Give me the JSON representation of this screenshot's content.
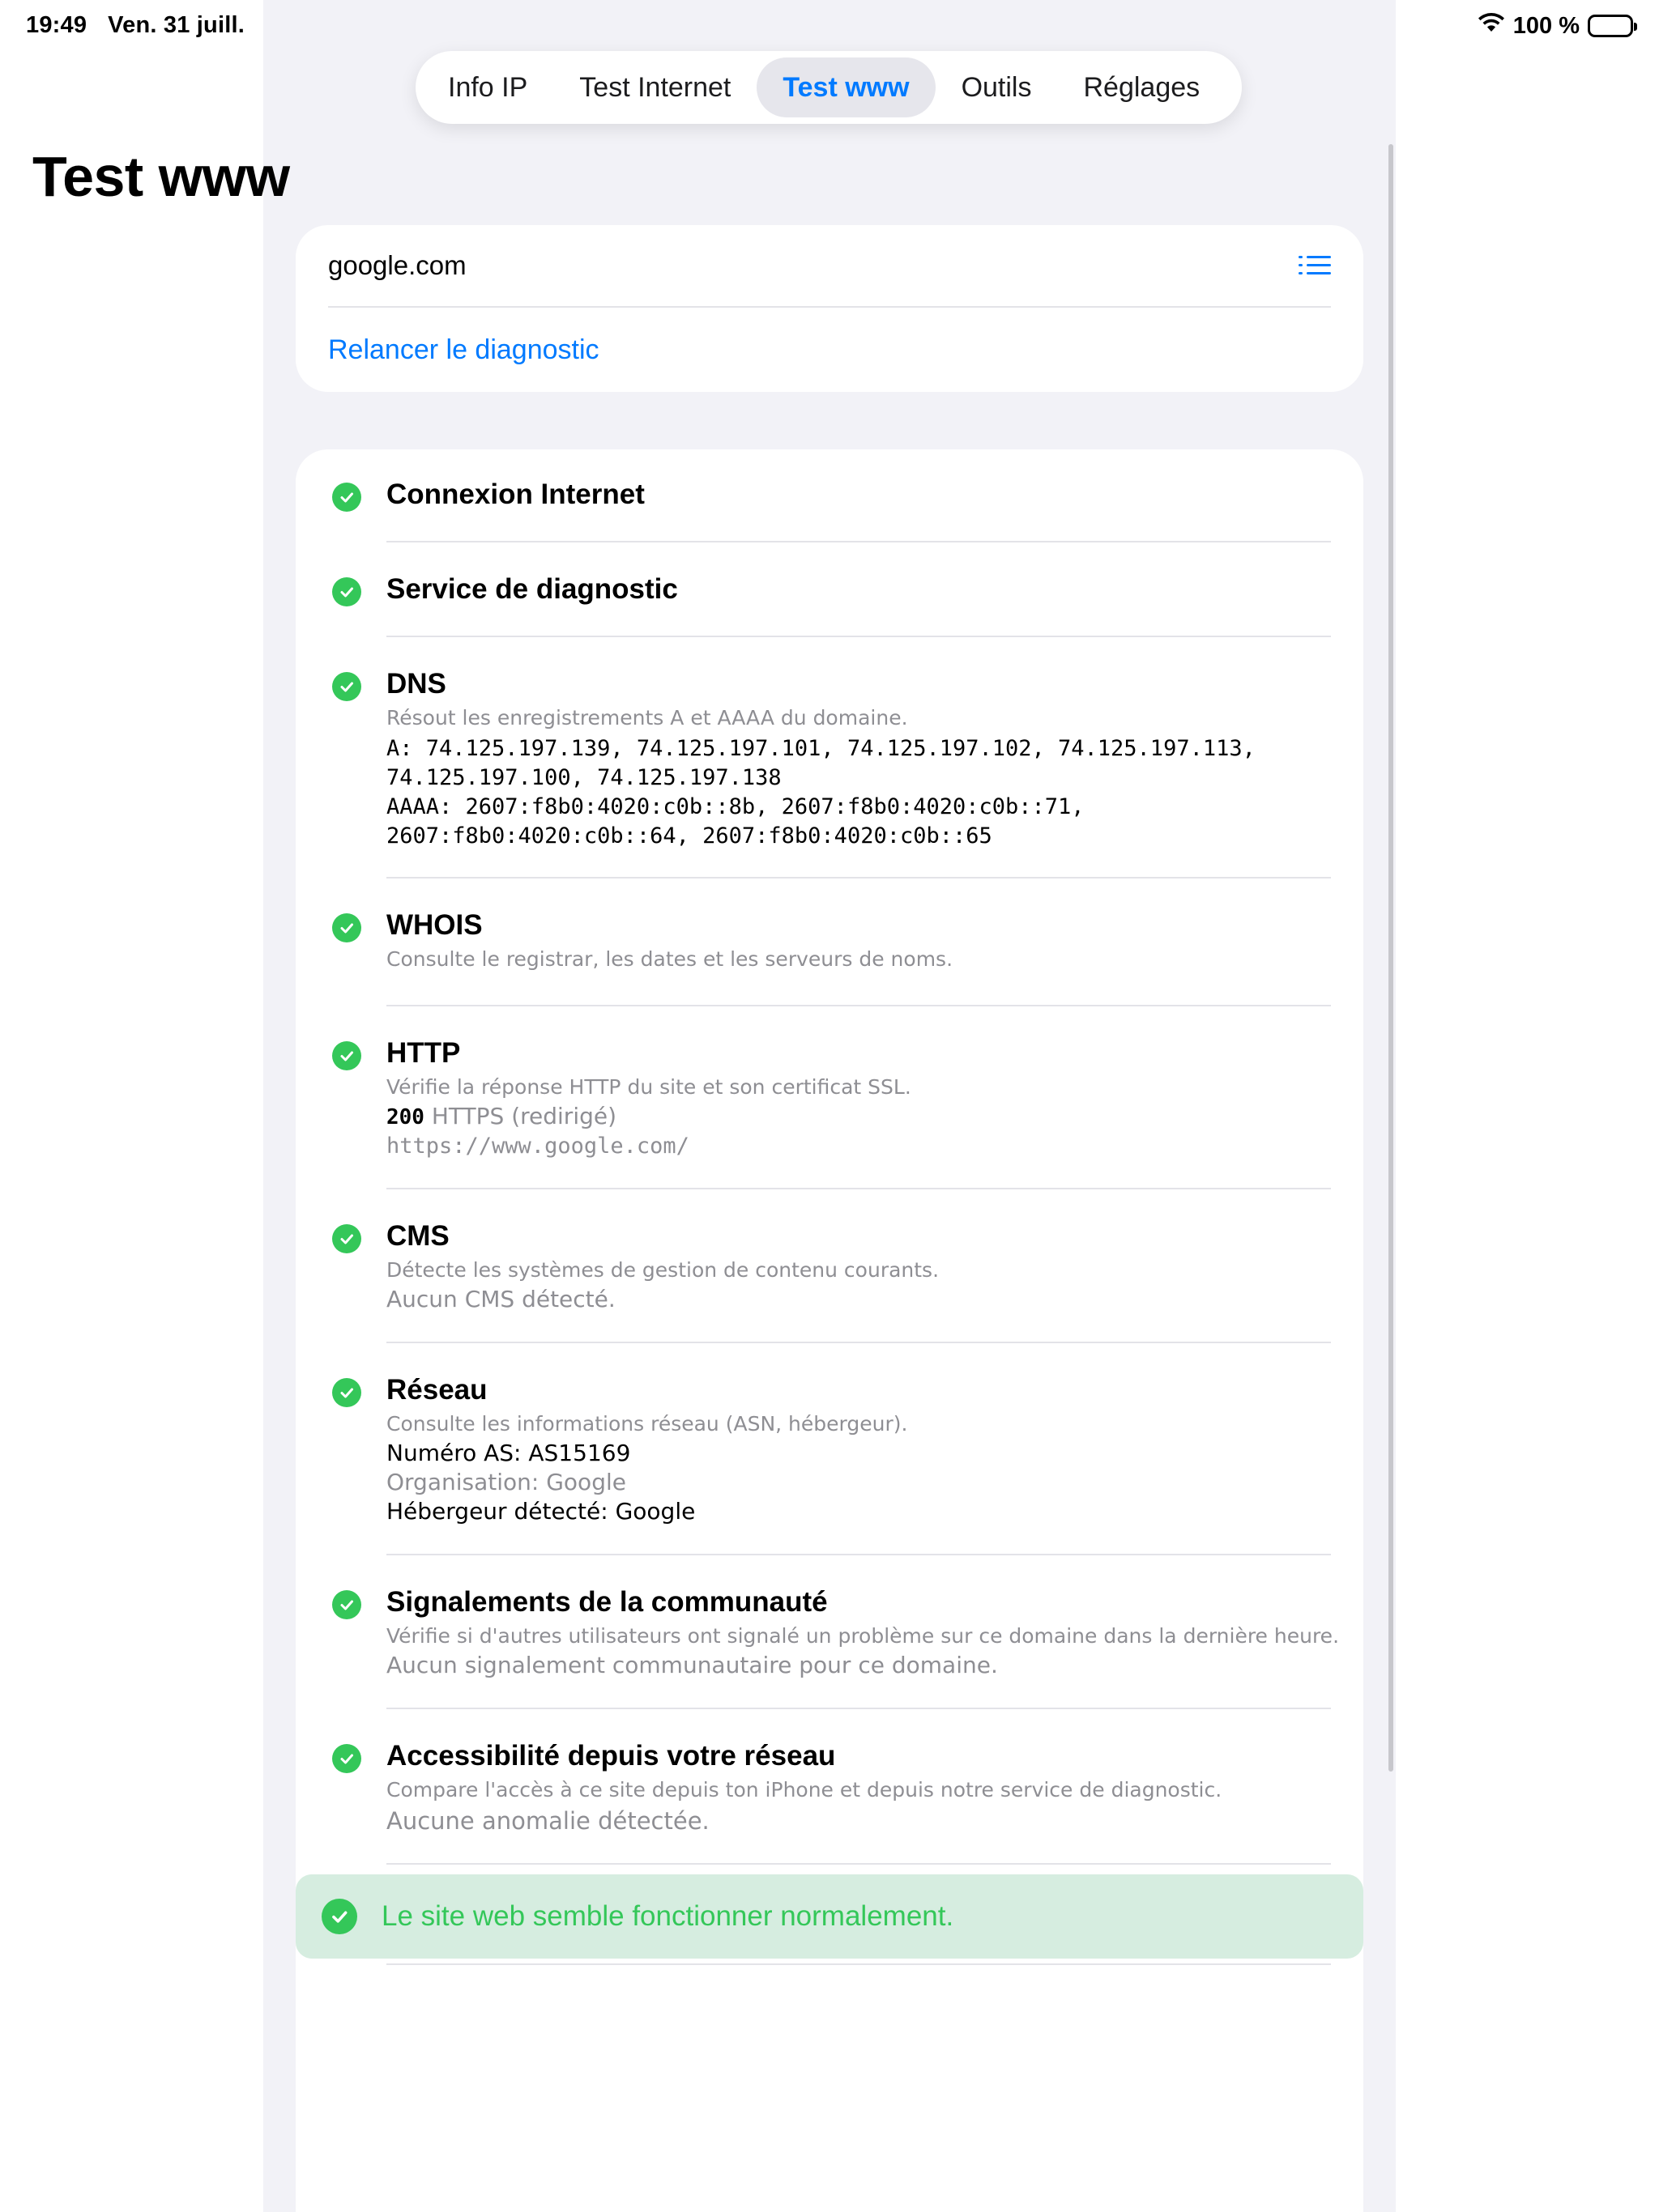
{
  "status_bar": {
    "time": "19:49",
    "date": "Ven. 31 juill.",
    "battery": "100 %",
    "icons": [
      "wifi-icon",
      "battery-icon"
    ]
  },
  "tabs": [
    {
      "label": "Info IP",
      "active": false
    },
    {
      "label": "Test Internet",
      "active": false
    },
    {
      "label": "Test www",
      "active": true
    },
    {
      "label": "Outils",
      "active": false
    },
    {
      "label": "Réglages",
      "active": false
    }
  ],
  "page_title": "Test www",
  "input_card": {
    "domain": "google.com",
    "relaunch_label": "Relancer le diagnostic",
    "list_icon": "list-icon"
  },
  "results": {
    "internet": {
      "title": "Connexion Internet"
    },
    "service": {
      "title": "Service de diagnostic"
    },
    "dns": {
      "title": "DNS",
      "desc": "Résout les enregistrements A et AAAA du domaine.",
      "a_line1": "A: 74.125.197.139, 74.125.197.101, 74.125.197.102, 74.125.197.113,",
      "a_line2": "74.125.197.100, 74.125.197.138",
      "aaaa_line1": "AAAA: 2607:f8b0:4020:c0b::8b, 2607:f8b0:4020:c0b::71,",
      "aaaa_line2": "2607:f8b0:4020:c0b::64, 2607:f8b0:4020:c0b::65"
    },
    "whois": {
      "title": "WHOIS",
      "desc": "Consulte le registrar, les dates et les serveurs de noms."
    },
    "http": {
      "title": "HTTP",
      "desc": "Vérifie la réponse HTTP du site et son certificat SSL.",
      "status_code": "200",
      "status_text": "HTTPS (redirigé)",
      "url": "https://www.google.com/"
    },
    "cms": {
      "title": "CMS",
      "desc": "Détecte les systèmes de gestion de contenu courants.",
      "result": "Aucun CMS détecté."
    },
    "network": {
      "title": "Réseau",
      "desc": "Consulte les informations réseau (ASN, hébergeur).",
      "asn": "Numéro AS: AS15169",
      "org": "Organisation: Google",
      "host": "Hébergeur détecté: Google"
    },
    "community": {
      "title": "Signalements de la communauté",
      "desc": "Vérifie si d'autres utilisateurs ont signalé un problème sur ce domaine dans la dernière heure.",
      "result": "Aucun signalement communautaire pour ce domaine."
    },
    "access": {
      "title": "Accessibilité depuis votre réseau",
      "desc": "Compare l'accès à ce site depuis ton iPhone et depuis notre service de diagnostic.",
      "result": "Aucune anomalie détectée."
    }
  },
  "summary": "Le site web semble fonctionner normalement.",
  "colors": {
    "accent": "#007aff",
    "success": "#34c759",
    "summary_bg": "#d6ede0",
    "grouped_bg": "#f2f2f7"
  }
}
